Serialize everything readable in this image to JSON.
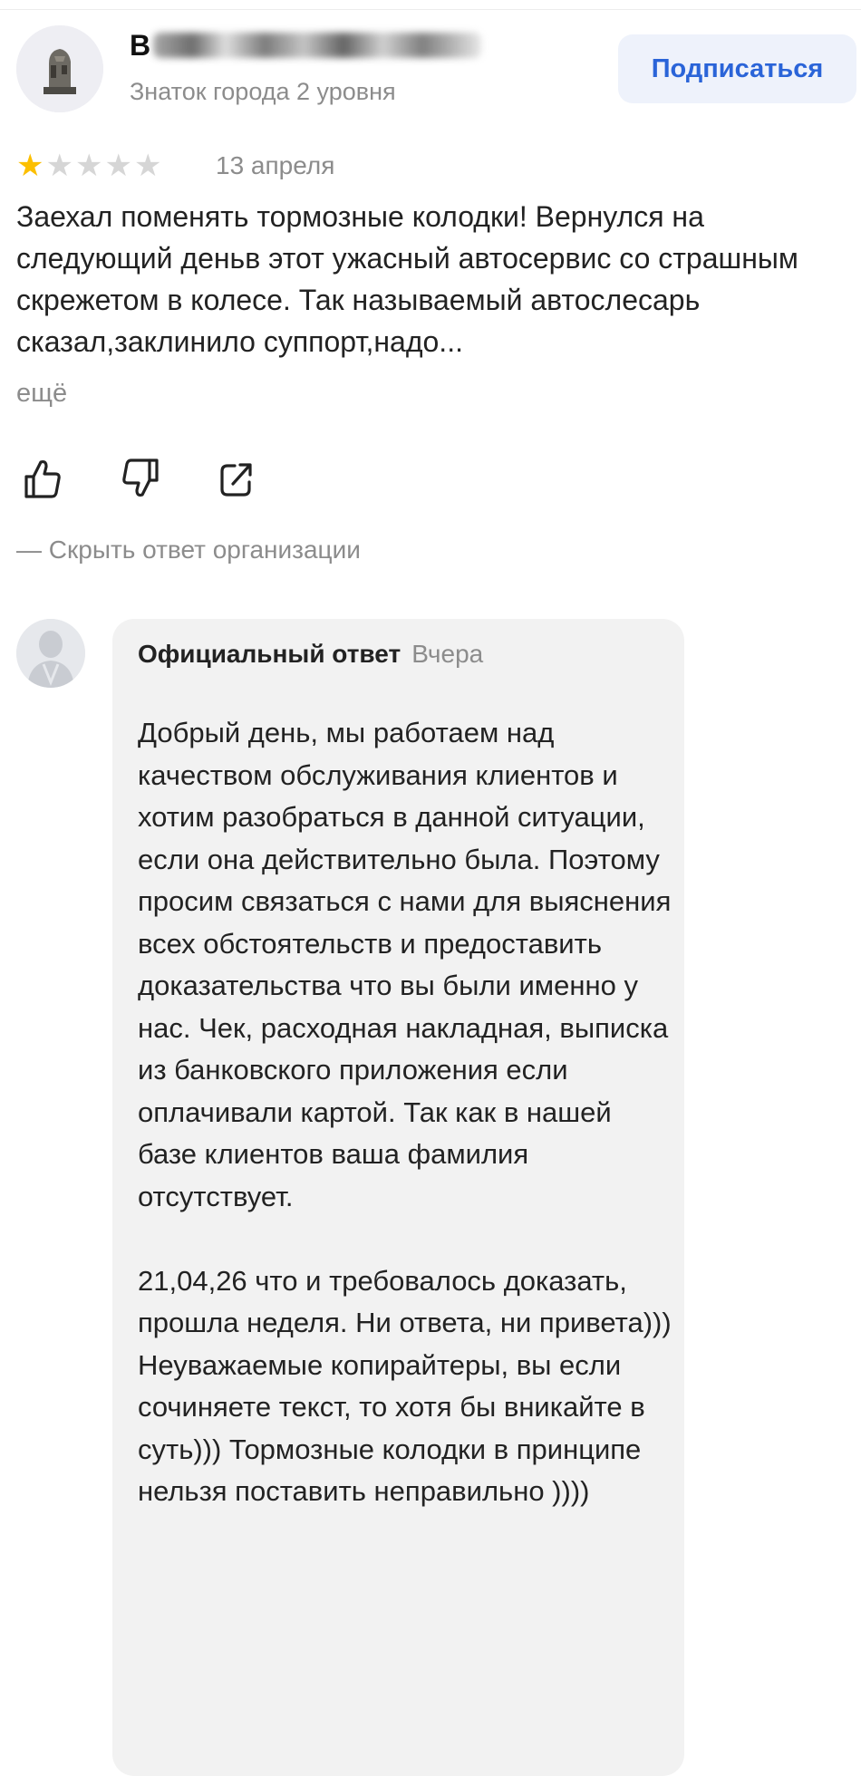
{
  "review": {
    "author": {
      "name_initial": "В",
      "level": "Знаток города 2 уровня"
    },
    "subscribe_label": "Подписаться",
    "rating": 1,
    "rating_max": 5,
    "date": "13 апреля",
    "text": "Заехал поменять тормозные колодки! Вернулся на следующий деньв этот ужасный автосервис со страшным скрежетом в колесе. Так называемый автослесарь сказал,заклинило суппорт,надо...",
    "more_label": "ещё",
    "actions": [
      "thumb-up-icon",
      "thumb-down-icon",
      "share-icon"
    ],
    "hide_answer_label": "— Скрыть ответ организации"
  },
  "answer": {
    "title": "Официальный ответ",
    "when": "Вчера",
    "paragraph1": "Добрый день, мы работаем над качеством обслуживания клиентов и хотим разобраться в данной ситуации, если она действительно была. Поэтому просим связаться с нами для выяснения всех обстоятельств и предоставить доказательства что вы были именно у нас. Чек, расходная накладная, выписка из банковского приложения если оплачивали картой. Так как в нашей базе клиентов ваша фамилия отсутствует.",
    "paragraph2": "21,04,26 что и требовалось доказать, прошла неделя. Ни ответа, ни привета))) Неуважаемые копирайтеры, вы если сочиняете текст, то хотя бы вникайте в суть))) Тормозные колодки в принципе нельзя поставить неправильно ))))"
  },
  "colors": {
    "accent": "#2a64d8",
    "star_active": "#fcbf00",
    "star_inactive": "#d6d6d6",
    "muted_text": "#8c8c8c",
    "bubble_bg": "#f2f2f2"
  }
}
